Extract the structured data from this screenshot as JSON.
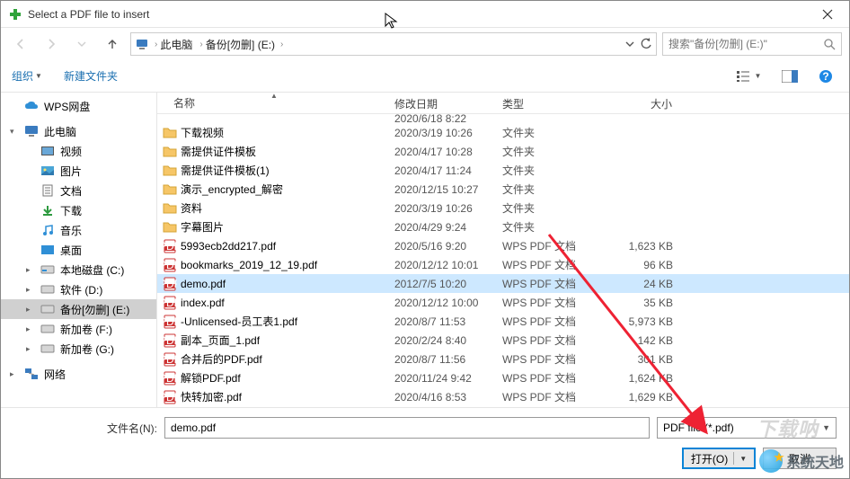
{
  "window": {
    "title": "Select a PDF file to insert"
  },
  "breadcrumb": {
    "items": [
      "此电脑",
      "备份[勿删] (E:)"
    ]
  },
  "search": {
    "placeholder": "搜索\"备份[勿删] (E:)\""
  },
  "toolbar": {
    "organize": "组织",
    "newfolder": "新建文件夹"
  },
  "columns": {
    "name": "名称",
    "date": "修改日期",
    "type": "类型",
    "size": "大小"
  },
  "sidebar": {
    "wps": "WPS网盘",
    "thispc": "此电脑",
    "video": "视频",
    "pictures": "图片",
    "documents": "文档",
    "downloads": "下载",
    "music": "音乐",
    "desktop": "桌面",
    "diskC": "本地磁盘 (C:)",
    "diskD": "软件 (D:)",
    "diskE": "备份[勿删] (E:)",
    "diskF": "新加卷 (F:)",
    "diskG": "新加卷 (G:)",
    "network": "网络"
  },
  "files": [
    {
      "icon": "folder",
      "name": "下载视频",
      "date": "2020/3/19 10:26",
      "type": "文件夹",
      "size": ""
    },
    {
      "icon": "folder",
      "name": "需提供证件模板",
      "date": "2020/4/17 10:28",
      "type": "文件夹",
      "size": ""
    },
    {
      "icon": "folder",
      "name": "需提供证件模板(1)",
      "date": "2020/4/17 11:24",
      "type": "文件夹",
      "size": ""
    },
    {
      "icon": "folder",
      "name": "演示_encrypted_解密",
      "date": "2020/12/15 10:27",
      "type": "文件夹",
      "size": ""
    },
    {
      "icon": "folder",
      "name": "资料",
      "date": "2020/3/19 10:26",
      "type": "文件夹",
      "size": ""
    },
    {
      "icon": "folder",
      "name": "字幕图片",
      "date": "2020/4/29 9:24",
      "type": "文件夹",
      "size": ""
    },
    {
      "icon": "pdf",
      "name": "5993ecb2dd217.pdf",
      "date": "2020/5/16 9:20",
      "type": "WPS PDF 文档",
      "size": "1,623 KB"
    },
    {
      "icon": "pdf",
      "name": "bookmarks_2019_12_19.pdf",
      "date": "2020/12/12 10:01",
      "type": "WPS PDF 文档",
      "size": "96 KB"
    },
    {
      "icon": "pdf",
      "name": "demo.pdf",
      "date": "2012/7/5 10:20",
      "type": "WPS PDF 文档",
      "size": "24 KB",
      "selected": true
    },
    {
      "icon": "pdf",
      "name": "index.pdf",
      "date": "2020/12/12 10:00",
      "type": "WPS PDF 文档",
      "size": "35 KB"
    },
    {
      "icon": "pdf",
      "name": "-Unlicensed-员工表1.pdf",
      "date": "2020/8/7 11:53",
      "type": "WPS PDF 文档",
      "size": "5,973 KB"
    },
    {
      "icon": "pdf",
      "name": "副本_页面_1.pdf",
      "date": "2020/2/24 8:40",
      "type": "WPS PDF 文档",
      "size": "142 KB"
    },
    {
      "icon": "pdf",
      "name": "合并后的PDF.pdf",
      "date": "2020/8/7 11:56",
      "type": "WPS PDF 文档",
      "size": "301 KB"
    },
    {
      "icon": "pdf",
      "name": "解锁PDF.pdf",
      "date": "2020/11/24 9:42",
      "type": "WPS PDF 文档",
      "size": "1,624 KB"
    },
    {
      "icon": "pdf",
      "name": "快转加密.pdf",
      "date": "2020/4/16 8:53",
      "type": "WPS PDF 文档",
      "size": "1,629 KB"
    }
  ],
  "truncated_row": {
    "date": "2020/6/18 8:22"
  },
  "filename": {
    "label": "文件名(N):",
    "value": "demo.pdf"
  },
  "filter": {
    "label": "PDF file (*.pdf)"
  },
  "buttons": {
    "open": "打开(O)",
    "cancel": "取消"
  },
  "watermark": {
    "text": "系统天地",
    "xzn": "下载呐"
  }
}
